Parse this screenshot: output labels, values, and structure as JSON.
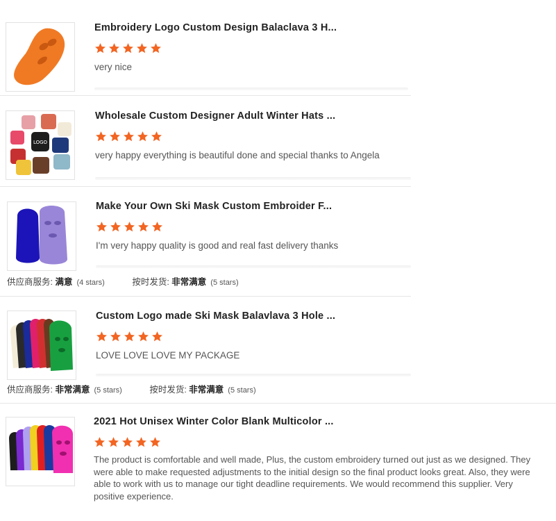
{
  "colors": {
    "star": "#f26522",
    "divider": "#e6e6e6"
  },
  "reviews": [
    {
      "title": "Embroidery Logo Custom Design Balaclava 3 H...",
      "rating": 5,
      "comment": "very nice",
      "thumb_icon": "orange-balaclava-image"
    },
    {
      "title": "Wholesale Custom Designer Adult Winter Hats ...",
      "rating": 5,
      "comment": "very happy everything is beautiful done and special thanks to Angela",
      "thumb_icon": "colorful-beanies-image",
      "thumb_logo": "LOGO"
    },
    {
      "title": "Make Your Own Ski Mask Custom Embroider F...",
      "rating": 5,
      "comment": "I'm very happy quality is good and real fast delivery thanks",
      "thumb_icon": "blue-purple-ski-masks-image",
      "meta": {
        "supplier_label": "供应商服务:",
        "supplier_value": "满意",
        "supplier_stars": "(4 stars)",
        "shipping_label": "按时发货:",
        "shipping_value": "非常满意",
        "shipping_stars": "(5 stars)"
      }
    },
    {
      "title": "Custom Logo made Ski Mask Balavlava 3 Hole ...",
      "rating": 5,
      "comment": "LOVE LOVE LOVE MY PACKAGE",
      "thumb_icon": "multicolor-ski-masks-image",
      "meta": {
        "supplier_label": "供应商服务:",
        "supplier_value": "非常满意",
        "supplier_stars": "(5 stars)",
        "shipping_label": "按时发货:",
        "shipping_value": "非常满意",
        "shipping_stars": "(5 stars)"
      }
    },
    {
      "title": "2021 Hot Unisex Winter Color Blank Multicolor ...",
      "rating": 5,
      "comment": "The product is comfortable and well made, Plus, the custom embroidery turned out just as we designed. They were able to make requested adjustments to the initial design so the final product looks great. Also, they were able to work with us to manage our tight deadline requirements. We would recommend this supplier. Very positive experience.",
      "thumb_icon": "rainbow-balaclavas-image"
    }
  ]
}
